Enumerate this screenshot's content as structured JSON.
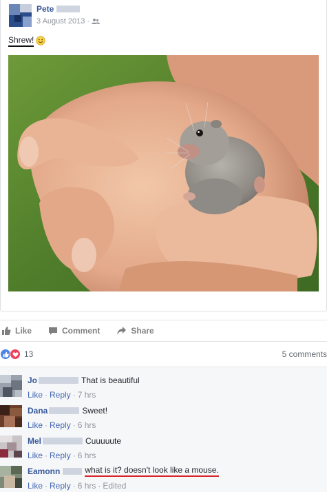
{
  "post": {
    "author_first": "Pete",
    "date": "3 August 2013",
    "date_sep": "·",
    "caption": "Shrew!"
  },
  "actions": {
    "like": "Like",
    "comment": "Comment",
    "share": "Share"
  },
  "reactions": {
    "count": "13",
    "comments": "5 comments"
  },
  "comments": [
    {
      "name": "Jo",
      "text": "That is beautiful",
      "like": "Like",
      "reply": "Reply",
      "time": "7 hrs",
      "edited": ""
    },
    {
      "name": "Dana",
      "text": "Sweet!",
      "like": "Like",
      "reply": "Reply",
      "time": "6 hrs",
      "edited": ""
    },
    {
      "name": "Mel",
      "text": "Cuuuuute",
      "like": "Like",
      "reply": "Reply",
      "time": "6 hrs",
      "edited": ""
    },
    {
      "name": "Eamonn",
      "text": "what is it? doesn't look like a mouse.",
      "like": "Like",
      "reply": "Reply",
      "time": "6 hrs",
      "edited": "Edited"
    }
  ],
  "icons": {
    "privacy": "friends-icon",
    "caption_emoji": "smiley-icon"
  },
  "colors": {
    "link": "#365899",
    "like_reaction": "#4e83e8",
    "love_reaction": "#f0415c",
    "annotation_underline": "#d8232a"
  }
}
